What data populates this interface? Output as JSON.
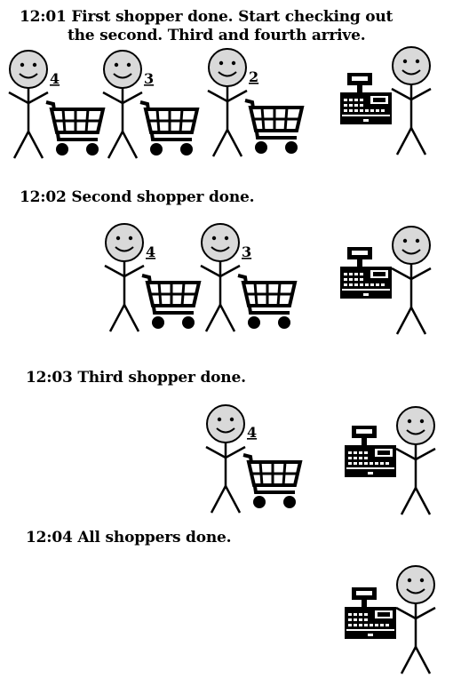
{
  "steps": [
    {
      "time": "12:01",
      "line1": "First shopper done. Start checking out",
      "line2": "the second. Third and fourth arrive.",
      "shoppers": [
        "4",
        "3",
        "2"
      ]
    },
    {
      "time": "12:02",
      "line1": "Second shopper done.",
      "line2": "",
      "shoppers": [
        "4",
        "3"
      ]
    },
    {
      "time": "12:03",
      "line1": "Third shopper done.",
      "line2": "",
      "shoppers": [
        "4"
      ]
    },
    {
      "time": "12:04",
      "line1": "All shoppers done.",
      "line2": "",
      "shoppers": []
    }
  ],
  "icons": {
    "shopper": "stick-figure-icon",
    "cart": "shopping-cart-icon",
    "register": "cash-register-icon",
    "cashier": "stick-figure-icon"
  },
  "colors": {
    "face": "#d9d9d9",
    "ink": "#000000"
  }
}
